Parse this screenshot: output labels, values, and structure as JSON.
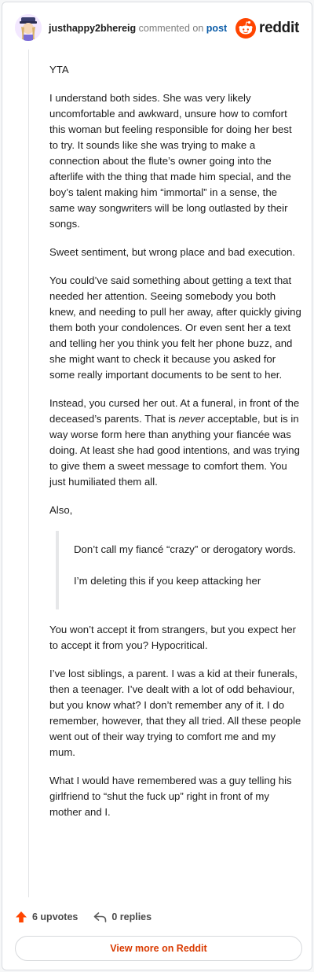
{
  "header": {
    "username": "justhappy2bhereig",
    "commented_on": "commented on",
    "post_link": "post",
    "brand": "reddit"
  },
  "comment": {
    "paragraphs": [
      "YTA",
      "I understand both sides. She was very likely uncomfortable and awkward, unsure how to comfort this woman but feeling responsible for doing her best to try. It sounds like she was trying to make a connection about the flute’s owner going into the afterlife with the thing that made him special, and the boy’s talent making him “immortal” in a sense, the same way songwriters will be long outlasted by their songs.",
      "Sweet sentiment, but wrong place and bad execution.",
      "You could’ve said something about getting a text that needed her attention. Seeing somebody you both knew, and needing to pull her away, after quickly giving them both your condolences. Or even sent her a text and telling her you think you felt her phone buzz, and she might want to check it because you asked for some really important documents to be sent to her.",
      {
        "before": "Instead, you cursed her out. At a funeral, in front of the deceased’s parents. That is ",
        "emphasis": "never",
        "after": " acceptable, but is in way worse form here than anything your fiancée was doing. At least she had good intentions, and was trying to give them a sweet message to comfort them. You just humiliated them all."
      },
      "Also,"
    ],
    "quote": [
      "Don’t call my fiancé “crazy” or derogatory words.",
      "I’m deleting this if you keep attacking her"
    ],
    "paragraphs_after": [
      "You won’t accept it from strangers, but you expect her to accept it from you? Hypocritical.",
      "I’ve lost siblings, a parent. I was a kid at their funerals, then a teenager. I’ve dealt with a lot of odd behaviour, but you know what? I don’t remember any of it. I do remember, however, that they all tried. All these people went out of their way trying to comfort me and my mum.",
      "What I would have remembered was a guy telling his girlfriend to “shut the fuck up” right in front of my mother and I."
    ]
  },
  "footer": {
    "upvotes": "6 upvotes",
    "replies": "0 replies",
    "view_more": "View more on Reddit"
  },
  "colors": {
    "accent": "#d93a00",
    "upvote": "#ff4500",
    "link": "#0b5ca8"
  },
  "icons": {
    "upvote": "upvote-arrow-icon",
    "reply": "reply-arrow-icon",
    "brand": "reddit-snoo-icon"
  }
}
